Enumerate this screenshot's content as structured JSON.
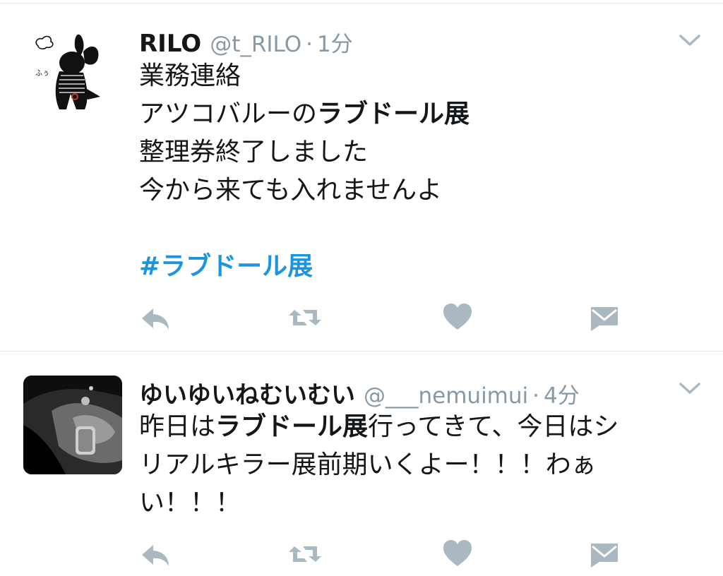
{
  "colors": {
    "text": "#14171a",
    "secondary": "#8899a6",
    "link": "#1b95e0",
    "icon": "#aab8c2",
    "divider": "#e1e8ed"
  },
  "tweets": [
    {
      "display_name": "RILO",
      "handle": "@t_RILO",
      "separator": "·",
      "time": "1分",
      "lines": [
        [
          {
            "t": "業務連絡"
          }
        ],
        [
          {
            "t": "アツコバルーの"
          },
          {
            "t": "ラブドール展",
            "b": true
          }
        ],
        [
          {
            "t": "整理券終了しました"
          }
        ],
        [
          {
            "t": "今から来ても入れませんよ"
          }
        ],
        [],
        [
          {
            "t": "#ラブドール展",
            "link": true
          }
        ]
      ],
      "actions": [
        "reply-icon",
        "retweet-icon",
        "like-icon",
        "direct-message-icon"
      ]
    },
    {
      "display_name": "ゆいゆいねむいむい",
      "handle": "@___nemuimui",
      "separator": "·",
      "time": "4分",
      "lines": [
        [
          {
            "t": "昨日は"
          },
          {
            "t": "ラブドール展",
            "b": true
          },
          {
            "t": "行ってきて、今日はシ"
          }
        ],
        [
          {
            "t": "リアルキラー展前期いくよー！！！わぁ"
          }
        ],
        [
          {
            "t": "い！！！"
          }
        ]
      ],
      "actions": [
        "reply-icon",
        "retweet-icon",
        "like-icon",
        "direct-message-icon"
      ]
    }
  ]
}
